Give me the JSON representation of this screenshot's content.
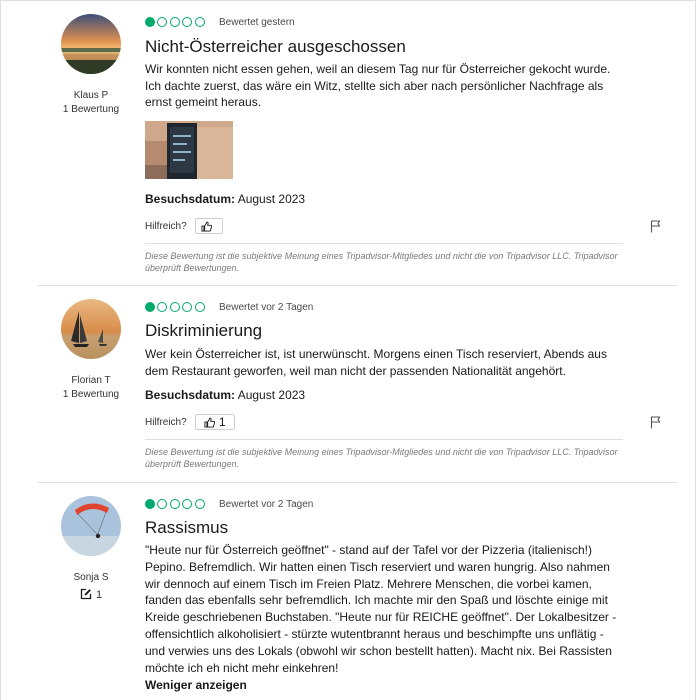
{
  "colors": {
    "bubble": "#00aa6c",
    "divider": "#e0e0e0",
    "disclaimer": "#7a7a7a"
  },
  "reviews": [
    {
      "user": "Klaus P",
      "contributions": "1 Bewertung",
      "rating": 1,
      "rating_max": 5,
      "date": "Bewertet gestern",
      "title": "Nicht-Österreicher ausgeschossen",
      "body": "Wir konnten nicht essen gehen, weil an diesem Tag nur für Österreicher gekocht wurde. Ich dachte zuerst, das wäre ein Witz, stellte sich aber nach persönlicher Nachfrage als ernst gemeint heraus.",
      "visit_label": "Besuchsdatum:",
      "visit_value": "August 2023",
      "helpful_label": "Hilfreich?",
      "helpful_count": "",
      "disclaimer": "Diese Bewertung ist die subjektive Meinung eines Tripadvisor-Mitgliedes und nicht die von Tripadvisor LLC. Tripadvisor überprüft Bewertungen."
    },
    {
      "user": "Florian T",
      "contributions": "1 Bewertung",
      "rating": 1,
      "rating_max": 5,
      "date": "Bewertet vor 2 Tagen",
      "title": "Diskriminierung",
      "body": "Wer kein Österreicher ist, ist unerwünscht. Morgens einen Tisch reserviert, Abends aus dem Restaurant geworfen, weil man nicht der passenden Nationalität angehört.",
      "visit_label": "Besuchsdatum:",
      "visit_value": "August 2023",
      "helpful_label": "Hilfreich?",
      "helpful_count": "1",
      "disclaimer": "Diese Bewertung ist die subjektive Meinung eines Tripadvisor-Mitgliedes und nicht die von Tripadvisor LLC. Tripadvisor überprüft Bewertungen."
    },
    {
      "user": "Sonja S",
      "contributions": "1",
      "rating": 1,
      "rating_max": 5,
      "date": "Bewertet vor 2 Tagen",
      "title": "Rassismus",
      "body": "\"Heute nur für Österreich geöffnet\" - stand auf der Tafel vor der Pizzeria (italienisch!) Pepino. Befremdlich. Wir hatten einen Tisch reserviert und waren hungrig. Also nahmen wir dennoch auf einem Tisch im Freien Platz. Mehrere Menschen, die vorbei kamen, fanden das ebenfalls sehr befremdlich. Ich machte mir den Spaß und löschte einige mit Kreide geschriebenen Buchstaben. \"Heute nur für REICHE geöffnet\". Der Lokalbesitzer - offensichtlich alkoholisiert - stürzte wutentbrannt heraus und beschimpfte uns unflätig - und verwies uns des Lokals (obwohl wir schon bestellt hatten). Macht nix. Bei Rassisten möchte ich eh nicht mehr einkehren!",
      "less_label": "Weniger anzeigen"
    }
  ],
  "icons": {
    "thumb": "thumbs-up-icon",
    "flag": "flag-icon",
    "contrib": "edit-contribution-icon"
  }
}
